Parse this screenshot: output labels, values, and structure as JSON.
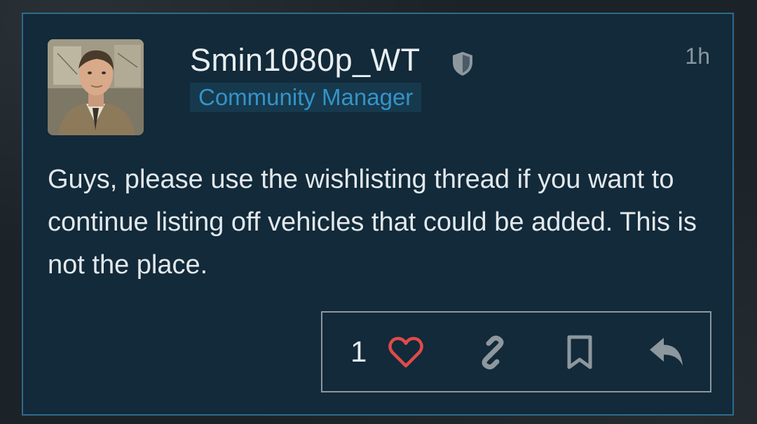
{
  "post": {
    "author": "Smin1080p_WT",
    "role": "Community Manager",
    "time": "1h",
    "body": "Guys, please use the wishlisting thread if you want to continue listing off vehicles that could be added. This is not the place."
  },
  "actions": {
    "like_count": "1",
    "icons": [
      "heart-icon",
      "link-icon",
      "bookmark-icon",
      "reply-icon"
    ]
  },
  "colors": {
    "card_bg": "#122a39",
    "card_border": "#2f6a8c",
    "role_text": "#3593c8",
    "heart": "#e04a4a",
    "icon_gray": "#8d979e"
  }
}
